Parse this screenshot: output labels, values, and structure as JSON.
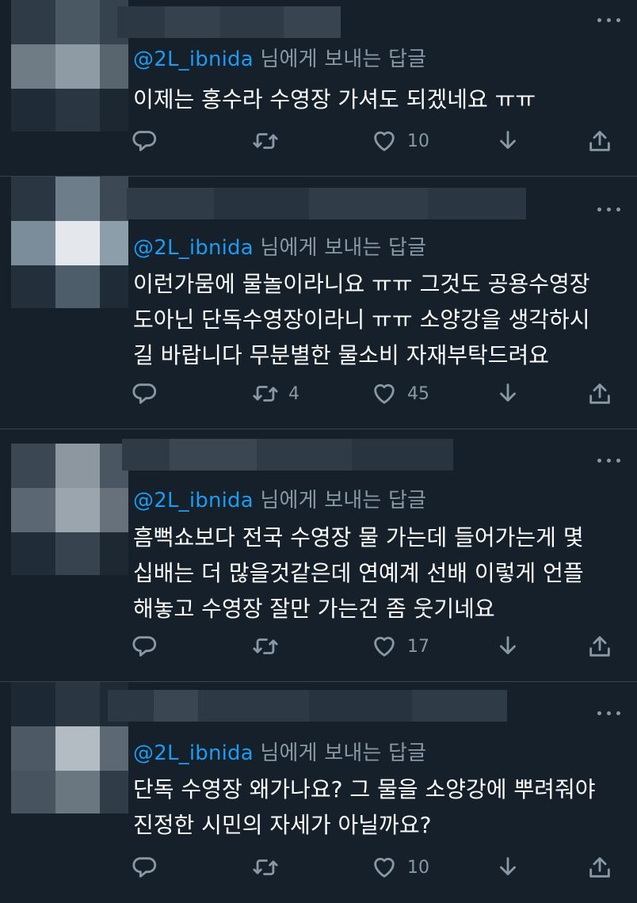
{
  "colors": {
    "background": "#15202b",
    "handle": "#1d9bf0",
    "secondary": "#8899a6",
    "text": "#ffffff"
  },
  "tweets": [
    {
      "reply_prefix": "@2L_ibnida",
      "reply_suffix": " 님에게 보내는 답글",
      "text": "이제는 홍수라 수영장 가셔도 되겠네요 ㅠㅠ",
      "retweets": "",
      "likes": "10"
    },
    {
      "reply_prefix": "@2L_ibnida",
      "reply_suffix": " 님에게 보내는 답글",
      "text": "이런가뭄에 물놀이라니요 ㅠㅠ 그것도 공용수영장\n도아닌 단독수영장이라니 ㅠㅠ 소양강을 생각하시\n길 바랍니다 무분별한 물소비 자재부탁드려요",
      "retweets": "4",
      "likes": "45"
    },
    {
      "reply_prefix": "@2L_ibnida",
      "reply_suffix": " 님에게 보내는 답글",
      "text": "흠뻑쇼보다 전국 수영장 물 가는데 들어가는게 몇\n십배는 더 많을것같은데 연예계 선배 이렇게 언플\n해놓고 수영장 잘만 가는건 좀 웃기네요",
      "retweets": "",
      "likes": "17"
    },
    {
      "reply_prefix": "@2L_ibnida",
      "reply_suffix": " 님에게 보내는 답글",
      "text": "단독 수영장 왜가나요? 그 물을 소양강에 뿌려줘야\n진정한 시민의 자세가 아닐까요?",
      "retweets": "",
      "likes": "10"
    }
  ]
}
